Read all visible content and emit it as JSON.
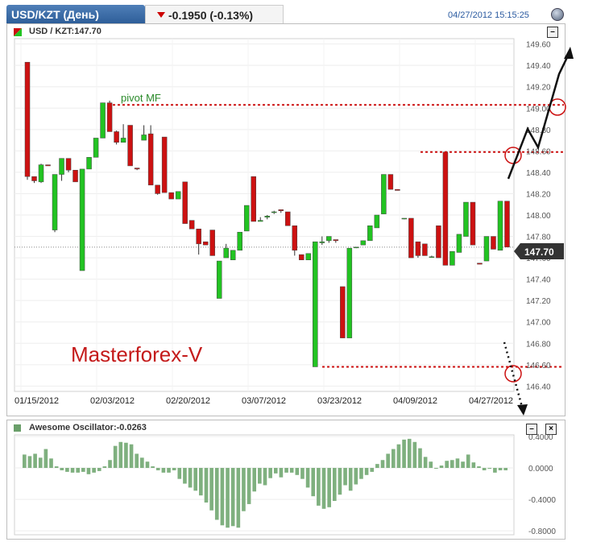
{
  "header": {
    "symbol_title": "USD/KZT (День)",
    "change": "-0.1950 (-0.13%)",
    "timestamp": "04/27/2012 15:15:25"
  },
  "main_panel": {
    "symbol_label": "USD / KZT:147.70",
    "price_tag": "147.70",
    "pivot_label": "pivot MF",
    "watermark": "Masterforex-V"
  },
  "oscillator_panel": {
    "label": "Awesome Oscillator:-0.0263"
  },
  "colors": {
    "up": "#22c322",
    "down": "#cc1111",
    "pivot_line": "#cc1111",
    "osc_bar": "#7fb07f",
    "price_tag_bg": "#333333"
  },
  "chart_data": [
    {
      "type": "candlestick",
      "title": "USD / KZT:147.70",
      "x_tick_labels": [
        "01/15/2012",
        "02/03/2012",
        "02/20/2012",
        "03/07/2012",
        "03/23/2012",
        "04/09/2012",
        "04/27/2012"
      ],
      "y_ticks": [
        146.4,
        146.6,
        146.8,
        147.0,
        147.2,
        147.4,
        147.6,
        147.8,
        148.0,
        148.2,
        148.4,
        148.6,
        148.8,
        149.0,
        149.2,
        149.4,
        149.6
      ],
      "ylim": [
        146.35,
        149.65
      ],
      "grid": true,
      "last_price": 147.7,
      "pivot_levels": [
        149.03,
        148.59,
        146.58
      ],
      "candles": [
        {
          "o": 149.43,
          "h": 149.43,
          "l": 148.33,
          "c": 148.36
        },
        {
          "o": 148.36,
          "h": 148.36,
          "l": 148.3,
          "c": 148.32
        },
        {
          "o": 148.31,
          "h": 148.48,
          "l": 148.3,
          "c": 148.47
        },
        {
          "o": 148.47,
          "h": 148.47,
          "l": 148.46,
          "c": 148.46
        },
        {
          "o": 147.86,
          "h": 148.38,
          "l": 147.84,
          "c": 148.38
        },
        {
          "o": 148.38,
          "h": 148.53,
          "l": 148.32,
          "c": 148.53
        },
        {
          "o": 148.53,
          "h": 148.53,
          "l": 148.4,
          "c": 148.42
        },
        {
          "o": 148.42,
          "h": 148.42,
          "l": 148.31,
          "c": 148.31
        },
        {
          "o": 147.48,
          "h": 148.43,
          "l": 147.48,
          "c": 148.43
        },
        {
          "o": 148.43,
          "h": 148.54,
          "l": 148.43,
          "c": 148.54
        },
        {
          "o": 148.54,
          "h": 148.72,
          "l": 148.54,
          "c": 148.72
        },
        {
          "o": 148.72,
          "h": 149.05,
          "l": 148.72,
          "c": 149.05
        },
        {
          "o": 149.05,
          "h": 149.07,
          "l": 148.78,
          "c": 148.78
        },
        {
          "o": 148.78,
          "h": 148.79,
          "l": 148.66,
          "c": 148.68
        },
        {
          "o": 148.68,
          "h": 148.85,
          "l": 148.68,
          "c": 148.72
        },
        {
          "o": 148.84,
          "h": 148.84,
          "l": 148.46,
          "c": 148.46
        },
        {
          "o": 148.44,
          "h": 148.44,
          "l": 148.42,
          "c": 148.43
        },
        {
          "o": 148.7,
          "h": 148.84,
          "l": 148.7,
          "c": 148.75
        },
        {
          "o": 148.76,
          "h": 148.84,
          "l": 148.28,
          "c": 148.28
        },
        {
          "o": 148.28,
          "h": 148.28,
          "l": 148.19,
          "c": 148.2
        },
        {
          "o": 148.73,
          "h": 148.73,
          "l": 148.21,
          "c": 148.21
        },
        {
          "o": 148.21,
          "h": 148.21,
          "l": 148.15,
          "c": 148.15
        },
        {
          "o": 148.15,
          "h": 148.22,
          "l": 148.15,
          "c": 148.22
        },
        {
          "o": 148.31,
          "h": 148.31,
          "l": 147.92,
          "c": 147.92
        },
        {
          "o": 147.95,
          "h": 147.95,
          "l": 147.87,
          "c": 147.87
        },
        {
          "o": 147.87,
          "h": 147.87,
          "l": 147.63,
          "c": 147.73
        },
        {
          "o": 147.75,
          "h": 147.75,
          "l": 147.72,
          "c": 147.72
        },
        {
          "o": 147.86,
          "h": 147.86,
          "l": 147.62,
          "c": 147.62
        },
        {
          "o": 147.22,
          "h": 147.57,
          "l": 147.22,
          "c": 147.57
        },
        {
          "o": 147.6,
          "h": 147.73,
          "l": 147.6,
          "c": 147.69
        },
        {
          "o": 147.58,
          "h": 147.67,
          "l": 147.58,
          "c": 147.67
        },
        {
          "o": 147.67,
          "h": 147.84,
          "l": 147.67,
          "c": 147.84
        },
        {
          "o": 147.85,
          "h": 148.09,
          "l": 147.85,
          "c": 148.09
        },
        {
          "o": 148.36,
          "h": 148.36,
          "l": 147.94,
          "c": 147.94
        },
        {
          "o": 147.94,
          "h": 147.98,
          "l": 147.94,
          "c": 147.95
        },
        {
          "o": 147.98,
          "h": 148.0,
          "l": 147.96,
          "c": 147.99
        },
        {
          "o": 148.03,
          "h": 148.04,
          "l": 148.01,
          "c": 148.03
        },
        {
          "o": 148.05,
          "h": 148.05,
          "l": 148.02,
          "c": 148.04
        },
        {
          "o": 148.03,
          "h": 148.03,
          "l": 147.9,
          "c": 147.9
        },
        {
          "o": 147.9,
          "h": 147.9,
          "l": 147.62,
          "c": 147.67
        },
        {
          "o": 147.63,
          "h": 147.63,
          "l": 147.58,
          "c": 147.58
        },
        {
          "o": 147.58,
          "h": 147.64,
          "l": 147.58,
          "c": 147.64
        },
        {
          "o": 146.58,
          "h": 147.75,
          "l": 146.58,
          "c": 147.75
        },
        {
          "o": 147.74,
          "h": 147.8,
          "l": 147.72,
          "c": 147.75
        },
        {
          "o": 147.76,
          "h": 147.8,
          "l": 147.74,
          "c": 147.8
        },
        {
          "o": 147.77,
          "h": 147.77,
          "l": 147.74,
          "c": 147.76
        },
        {
          "o": 147.33,
          "h": 147.33,
          "l": 146.85,
          "c": 146.85
        },
        {
          "o": 146.85,
          "h": 147.69,
          "l": 146.85,
          "c": 147.69
        },
        {
          "o": 147.7,
          "h": 147.7,
          "l": 147.69,
          "c": 147.7
        },
        {
          "o": 147.72,
          "h": 147.76,
          "l": 147.72,
          "c": 147.76
        },
        {
          "o": 147.76,
          "h": 147.9,
          "l": 147.76,
          "c": 147.9
        },
        {
          "o": 147.88,
          "h": 148.0,
          "l": 147.88,
          "c": 148.0
        },
        {
          "o": 148.01,
          "h": 148.38,
          "l": 148.01,
          "c": 148.38
        },
        {
          "o": 148.38,
          "h": 148.38,
          "l": 148.24,
          "c": 148.24
        },
        {
          "o": 148.24,
          "h": 148.24,
          "l": 148.23,
          "c": 148.23
        },
        {
          "o": 147.97,
          "h": 147.97,
          "l": 147.96,
          "c": 147.97
        },
        {
          "o": 147.97,
          "h": 147.97,
          "l": 147.6,
          "c": 147.6
        },
        {
          "o": 147.75,
          "h": 147.75,
          "l": 147.6,
          "c": 147.62
        },
        {
          "o": 147.73,
          "h": 147.73,
          "l": 147.62,
          "c": 147.62
        },
        {
          "o": 147.61,
          "h": 147.62,
          "l": 147.6,
          "c": 147.61
        },
        {
          "o": 147.9,
          "h": 147.9,
          "l": 147.6,
          "c": 147.6
        },
        {
          "o": 148.59,
          "h": 148.59,
          "l": 147.53,
          "c": 147.53
        },
        {
          "o": 147.53,
          "h": 147.66,
          "l": 147.53,
          "c": 147.66
        },
        {
          "o": 147.65,
          "h": 147.82,
          "l": 147.65,
          "c": 147.82
        },
        {
          "o": 147.8,
          "h": 148.12,
          "l": 147.8,
          "c": 148.12
        },
        {
          "o": 148.12,
          "h": 148.12,
          "l": 147.72,
          "c": 147.72
        },
        {
          "o": 147.55,
          "h": 147.55,
          "l": 147.54,
          "c": 147.54
        },
        {
          "o": 147.57,
          "h": 147.8,
          "l": 147.57,
          "c": 147.8
        },
        {
          "o": 147.8,
          "h": 147.8,
          "l": 147.68,
          "c": 147.68
        },
        {
          "o": 147.67,
          "h": 148.13,
          "l": 147.67,
          "c": 148.13
        },
        {
          "o": 148.13,
          "h": 148.13,
          "l": 147.7,
          "c": 147.7
        }
      ]
    },
    {
      "type": "bar",
      "title": "Awesome Oscillator:-0.0263",
      "y_ticks": [
        0.4,
        0.0,
        -0.4,
        -0.8
      ],
      "ylim": [
        -0.85,
        0.42
      ],
      "values": [
        0.17,
        0.15,
        0.18,
        0.13,
        0.24,
        0.12,
        0.02,
        -0.03,
        -0.05,
        -0.06,
        -0.06,
        -0.05,
        -0.08,
        -0.06,
        -0.04,
        0.02,
        0.1,
        0.28,
        0.33,
        0.32,
        0.3,
        0.18,
        0.13,
        0.08,
        0.02,
        -0.03,
        -0.06,
        -0.06,
        -0.03,
        -0.14,
        -0.2,
        -0.25,
        -0.29,
        -0.35,
        -0.44,
        -0.54,
        -0.66,
        -0.73,
        -0.76,
        -0.74,
        -0.76,
        -0.55,
        -0.46,
        -0.3,
        -0.2,
        -0.22,
        -0.13,
        -0.07,
        -0.12,
        -0.06,
        -0.06,
        -0.09,
        -0.14,
        -0.25,
        -0.36,
        -0.48,
        -0.52,
        -0.5,
        -0.42,
        -0.34,
        -0.22,
        -0.29,
        -0.21,
        -0.14,
        -0.09,
        -0.05,
        0.05,
        0.1,
        0.18,
        0.24,
        0.3,
        0.36,
        0.37,
        0.33,
        0.25,
        0.14,
        0.08,
        -0.01,
        0.03,
        0.09,
        0.1,
        0.12,
        0.08,
        0.17,
        0.07,
        0.02,
        -0.03,
        0.0,
        -0.06,
        -0.03,
        -0.03
      ]
    }
  ]
}
